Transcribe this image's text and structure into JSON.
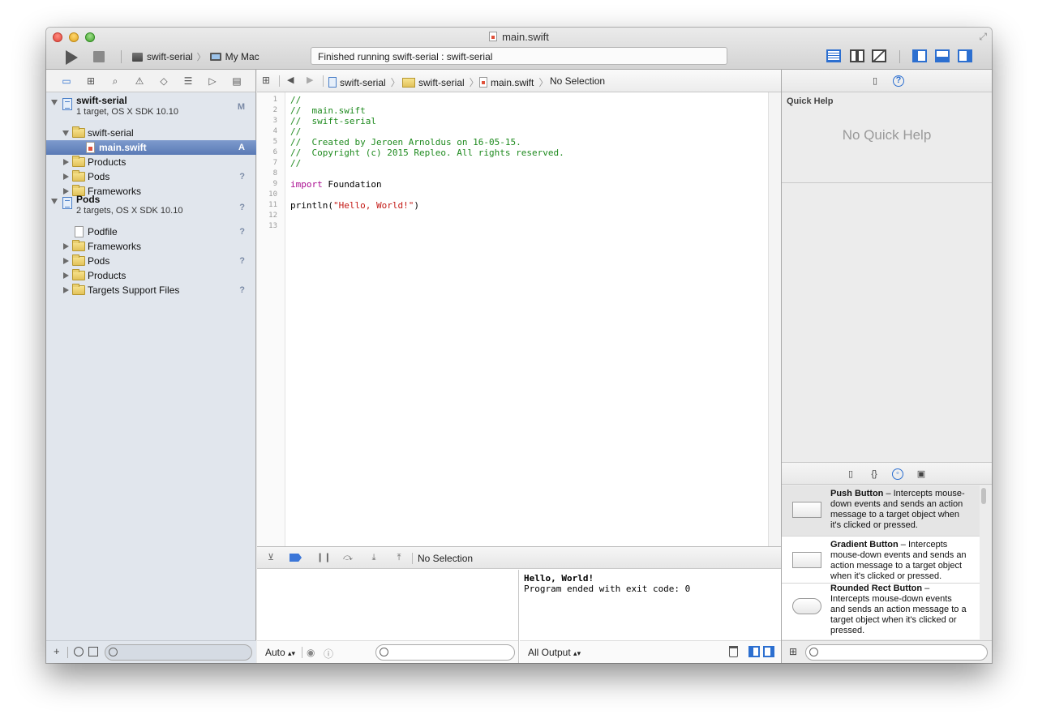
{
  "window": {
    "title": "main.swift"
  },
  "toolbar": {
    "scheme": "swift-serial",
    "destination": "My Mac",
    "activity": "Finished running swift-serial : swift-serial",
    "icons": [
      "run-icon",
      "stop-icon",
      "standard-editor-icon",
      "assistant-editor-icon",
      "version-editor-icon",
      "navigator-toggle-icon",
      "debug-area-toggle-icon",
      "utilities-toggle-icon"
    ]
  },
  "navigator": {
    "tabs": [
      "project-navigator-icon",
      "symbol-navigator-icon",
      "find-navigator-icon",
      "issue-navigator-icon",
      "test-navigator-icon",
      "debug-navigator-icon",
      "breakpoint-navigator-icon",
      "log-navigator-icon"
    ],
    "tree": [
      {
        "name": "swift-serial",
        "subtitle": "1 target, OS X SDK 10.10",
        "badge": "M"
      },
      {
        "name": "swift-serial",
        "badge": ""
      },
      {
        "name": "main.swift",
        "badge": "A"
      },
      {
        "name": "Products",
        "badge": ""
      },
      {
        "name": "Pods",
        "badge": "?"
      },
      {
        "name": "Frameworks",
        "badge": ""
      },
      {
        "name": "Pods",
        "subtitle": "2 targets, OS X SDK 10.10",
        "badge": "?"
      },
      {
        "name": "Podfile",
        "badge": "?"
      },
      {
        "name": "Frameworks",
        "badge": ""
      },
      {
        "name": "Pods",
        "badge": "?"
      },
      {
        "name": "Products",
        "badge": ""
      },
      {
        "name": "Targets Support Files",
        "badge": "?"
      }
    ]
  },
  "jumpbar": {
    "crumbs": [
      "swift-serial",
      "swift-serial",
      "main.swift",
      "No Selection"
    ]
  },
  "editor": {
    "lines": [
      {
        "n": "1",
        "text": "//",
        "kind": "comment"
      },
      {
        "n": "2",
        "text": "//  main.swift",
        "kind": "comment"
      },
      {
        "n": "3",
        "text": "//  swift-serial",
        "kind": "comment"
      },
      {
        "n": "4",
        "text": "//",
        "kind": "comment"
      },
      {
        "n": "5",
        "text": "//  Created by Jeroen Arnoldus on 16-05-15.",
        "kind": "comment"
      },
      {
        "n": "6",
        "text": "//  Copyright (c) 2015 Repleo. All rights reserved.",
        "kind": "comment"
      },
      {
        "n": "7",
        "text": "//",
        "kind": "comment"
      },
      {
        "n": "8",
        "text": "",
        "kind": "plain"
      },
      {
        "n": "9",
        "keyword": "import",
        "rest": " Foundation",
        "kind": "import"
      },
      {
        "n": "10",
        "text": "",
        "kind": "plain"
      },
      {
        "n": "11",
        "call": "println(",
        "string": "\"Hello, World!\"",
        "close": ")",
        "kind": "call"
      },
      {
        "n": "12",
        "text": "",
        "kind": "plain"
      },
      {
        "n": "13",
        "text": "",
        "kind": "plain"
      }
    ]
  },
  "debug": {
    "selection": "No Selection",
    "variables_scope": "Auto",
    "console_output": [
      "Hello, World!",
      "Program ended with exit code: 0"
    ],
    "output_filter": "All Output"
  },
  "utilities": {
    "quick_help_title": "Quick Help",
    "quick_help_empty": "No Quick Help",
    "library": [
      {
        "name": "Push Button",
        "desc": " – Intercepts mouse-down events and sends an action message to a target object when it's clicked or pressed."
      },
      {
        "name": "Gradient Button",
        "desc": " – Intercepts mouse-down events and sends an action message to a target object when it's clicked or pressed."
      },
      {
        "name": "Rounded Rect Button",
        "desc": " – Intercepts mouse-down events and sends an action message to a target object when it's clicked or pressed."
      }
    ]
  },
  "colors": {
    "selection": "#5a7ab5",
    "comment": "#1e8a1e",
    "keyword": "#aa0d91",
    "string": "#c41a16",
    "accent": "#2c6fd0"
  }
}
